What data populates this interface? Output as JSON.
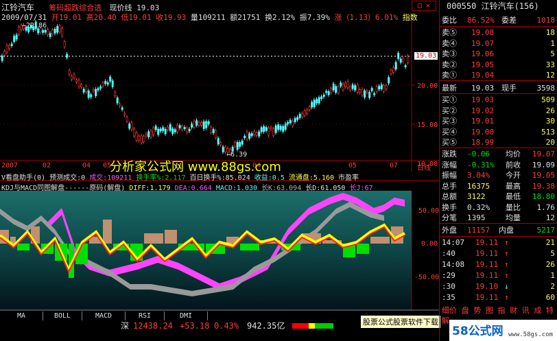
{
  "top_header": {
    "app_name": "江铃汽车",
    "indicator_title": "筹码超跌综合选",
    "price_line_label": "现价线 19.03",
    "date": "2009/07/31",
    "open": "开19.01",
    "high": "高20.40",
    "low": "低19.01",
    "close": "收19.93",
    "volume": "量109211",
    "amount": "额21751",
    "turnover": "换2.12%",
    "amplitude": "振7.39%",
    "change": "涨（1.13）6.01%",
    "tail": "指数"
  },
  "main_chart": {
    "price_axis": [
      "20.00",
      "15.00",
      "10.00"
    ],
    "current_price_tag": "19.03",
    "high_marker": "22.86",
    "low_marker": "6.39",
    "x_axis_labels": [
      "2007",
      "02",
      "04",
      "05",
      "04",
      "05",
      "07"
    ],
    "x_axis_right": "日线",
    "watermark": "分析家公式网 www.88gs.com",
    "market_cap_label": "市盈率"
  },
  "vol_header": {
    "title": "V看盘助手(0) 预测成交:0",
    "volume": "成交:109211",
    "turnover": "换手率%:2.117",
    "hundred_day": "百日换手%:85.024",
    "profit": "收益:0.5",
    "float": "流通盘:5.160"
  },
  "kdj_header": {
    "title": "KDJ与MACD同图解盘------原码(解盘)",
    "diff": "DIFF:1.179",
    "dea": "DEA:0.664",
    "macd": "MACD:1.030",
    "long_k": "长K:63.094",
    "long_d": "长D:61.050",
    "long_j": "长J:67"
  },
  "sub_chart": {
    "axis": [
      "50.00",
      "0.00",
      "-50.00"
    ]
  },
  "tabs": [
    "MA",
    "BOLL",
    "MACD",
    "RSI",
    "DMI"
  ],
  "status_bar": {
    "index_name": "深",
    "index_value": "12438.24",
    "index_change": "+53.18",
    "index_pct": "0.43%",
    "index_amount": "942.35亿",
    "ad_text": "股票公式股票软件下载"
  },
  "quote": {
    "code_name": "000550 江铃汽车(156)",
    "ratio_label": "委比",
    "ratio_value": "86.52%",
    "diff_label": "委差",
    "diff_value": "1018",
    "asks": [
      {
        "label": "卖⑤",
        "price": "19.08",
        "vol": "18"
      },
      {
        "label": "卖④",
        "price": "19.07",
        "vol": "1"
      },
      {
        "label": "卖③",
        "price": "19.06",
        "vol": "5"
      },
      {
        "label": "卖②",
        "price": "19.05",
        "vol": "33"
      },
      {
        "label": "卖①",
        "price": "19.04",
        "vol": "12"
      }
    ],
    "latest_label": "最新",
    "latest_value": "19.03",
    "now_vol_label": "现手",
    "now_vol_value": "3598",
    "bids": [
      {
        "label": "买①",
        "price": "19.03",
        "vol": "509"
      },
      {
        "label": "买②",
        "price": "19.02",
        "vol": "26"
      },
      {
        "label": "买③",
        "price": "19.01",
        "vol": "30"
      },
      {
        "label": "买④",
        "price": "19.00",
        "vol": "513"
      },
      {
        "label": "买⑤",
        "price": "18.99",
        "vol": "20"
      }
    ],
    "stats": [
      {
        "l1": "涨跌",
        "v1": "-0.06",
        "l2": "均价",
        "v2": "19.07"
      },
      {
        "l1": "涨幅",
        "v1": "-0.31%",
        "l2": "前收",
        "v2": "19.09"
      },
      {
        "l1": "振幅",
        "v1": "3.04%",
        "l2": "今开",
        "v2": "19.05"
      },
      {
        "l1": "总手",
        "v1": "16375",
        "l2": "最高",
        "v2": "19.38"
      },
      {
        "l1": "总额",
        "v1": "3122",
        "l2": "最低",
        "v2": "18.80"
      },
      {
        "l1": "换手",
        "v1": "0.32%",
        "l2": "量比",
        "v2": "1.76"
      },
      {
        "l1": "分笔",
        "v1": "1395",
        "l2": "均量",
        "v2": "12"
      }
    ],
    "outer_label": "外盘",
    "outer_value": "11157",
    "inner_label": "内盘",
    "inner_value": "5217",
    "ticks": [
      {
        "time": "14:07",
        "price": "19.11",
        "dir": "↑",
        "vol": "21"
      },
      {
        "time": ":40",
        "price": "19.11",
        "dir": "↑",
        "vol": "5"
      },
      {
        "time": "14:08",
        "price": "19.11",
        "dir": "↑",
        "vol": "26"
      },
      {
        "time": ":29",
        "price": "19.11",
        "dir": "↑",
        "vol": "1"
      },
      {
        "time": ":30",
        "price": "19.10",
        "dir": "↓",
        "vol": "2"
      },
      {
        "time": ":35",
        "price": "19.11",
        "dir": "↑",
        "vol": "60"
      }
    ],
    "bottom_tabs": "细价 盘 势 图 指 财 讯 成 特 解",
    "logo": "58公式网",
    "logo_url": "www.58gs.com"
  }
}
